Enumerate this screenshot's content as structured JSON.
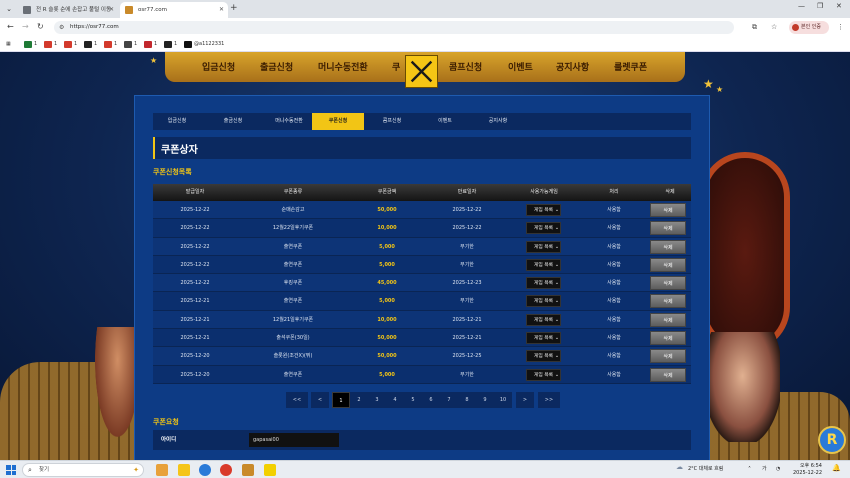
{
  "browser": {
    "tabs": [
      {
        "title": "전 R 슬롯 순에 손잡고 풀털 이동"
      },
      {
        "title": "osr77.com"
      }
    ],
    "new_tab": "+",
    "url": "https://osr77.com",
    "profile_label": "본인 인증",
    "bookmarks": [
      {
        "label": "1",
        "color": "#1e7a35"
      },
      {
        "label": "1",
        "color": "#d33a2c"
      },
      {
        "label": "1",
        "color": "#d33a2c"
      },
      {
        "label": "1",
        "color": "#222222"
      },
      {
        "label": "1",
        "color": "#d33a2c"
      },
      {
        "label": "1",
        "color": "#444444"
      },
      {
        "label": "1",
        "color": "#c2272d"
      },
      {
        "label": "1",
        "color": "#222222"
      },
      {
        "label": "@a1122331",
        "color": "#111111"
      }
    ]
  },
  "site": {
    "top_menu": [
      "입금신청",
      "출금신청",
      "머니수동전환",
      "쿠",
      "콤프신청",
      "이벤트",
      "공지사항",
      "룰렛쿠폰"
    ],
    "sub_nav": [
      "입금신청",
      "출금신청",
      "머니수동전환",
      "쿠폰신청",
      "콤프신청",
      "이벤트",
      "공지사항"
    ],
    "sub_nav_active": 3,
    "page_title": "쿠폰상자",
    "list_title": "쿠폰신청목록",
    "columns": [
      "발급일자",
      "쿠폰종류",
      "쿠폰금액",
      "만료일자",
      "사용가능게임",
      "처리",
      "삭제"
    ],
    "rows": [
      {
        "date": "2025-12-22",
        "type": "순매손감고",
        "amount": "50,000",
        "expire": "2025-12-22",
        "game": "게임 목록",
        "status": "사용함",
        "del": "삭제"
      },
      {
        "date": "2025-12-22",
        "type": "12월22일후기쿠폰",
        "amount": "10,000",
        "expire": "2025-12-22",
        "game": "게임 목록",
        "status": "사용함",
        "del": "삭제"
      },
      {
        "date": "2025-12-22",
        "type": "출연쿠폰",
        "amount": "5,000",
        "expire": "무기한",
        "game": "게임 목록",
        "status": "사용함",
        "del": "삭제"
      },
      {
        "date": "2025-12-22",
        "type": "출연쿠폰",
        "amount": "5,000",
        "expire": "무기한",
        "game": "게임 목록",
        "status": "사용함",
        "del": "삭제"
      },
      {
        "date": "2025-12-22",
        "type": "후킹쿠폰",
        "amount": "45,000",
        "expire": "2025-12-23",
        "game": "게임 목록",
        "status": "사용함",
        "del": "삭제"
      },
      {
        "date": "2025-12-21",
        "type": "출연쿠폰",
        "amount": "5,000",
        "expire": "무기한",
        "game": "게임 목록",
        "status": "사용함",
        "del": "삭제"
      },
      {
        "date": "2025-12-21",
        "type": "12월21일후기쿠폰",
        "amount": "10,000",
        "expire": "2025-12-21",
        "game": "게임 목록",
        "status": "사용함",
        "del": "삭제"
      },
      {
        "date": "2025-12-21",
        "type": "출석쿠폰(30일)",
        "amount": "50,000",
        "expire": "2025-12-21",
        "game": "게임 목록",
        "status": "사용함",
        "del": "삭제"
      },
      {
        "date": "2025-12-20",
        "type": "솔롯윈(조건X)(뛰)",
        "amount": "50,000",
        "expire": "2025-12-25",
        "game": "게임 목록",
        "status": "사용함",
        "del": "삭제"
      },
      {
        "date": "2025-12-20",
        "type": "출연쿠폰",
        "amount": "5,000",
        "expire": "무기한",
        "game": "게임 목록",
        "status": "사용함",
        "del": "삭제"
      }
    ],
    "pagination": [
      "<<",
      "<",
      "1",
      "2",
      "3",
      "4",
      "5",
      "6",
      "7",
      "8",
      "9",
      "10",
      ">",
      ">>"
    ],
    "pagination_active": "1",
    "request_title": "쿠폰요청",
    "request_id_label": "아이디",
    "request_id_value": "gapasai00",
    "logo_letter": "R"
  },
  "taskbar": {
    "search_placeholder": "찾기",
    "weather": "2°C  대체로 흐림",
    "time": "오후 6:54",
    "date": "2025-12-22"
  }
}
